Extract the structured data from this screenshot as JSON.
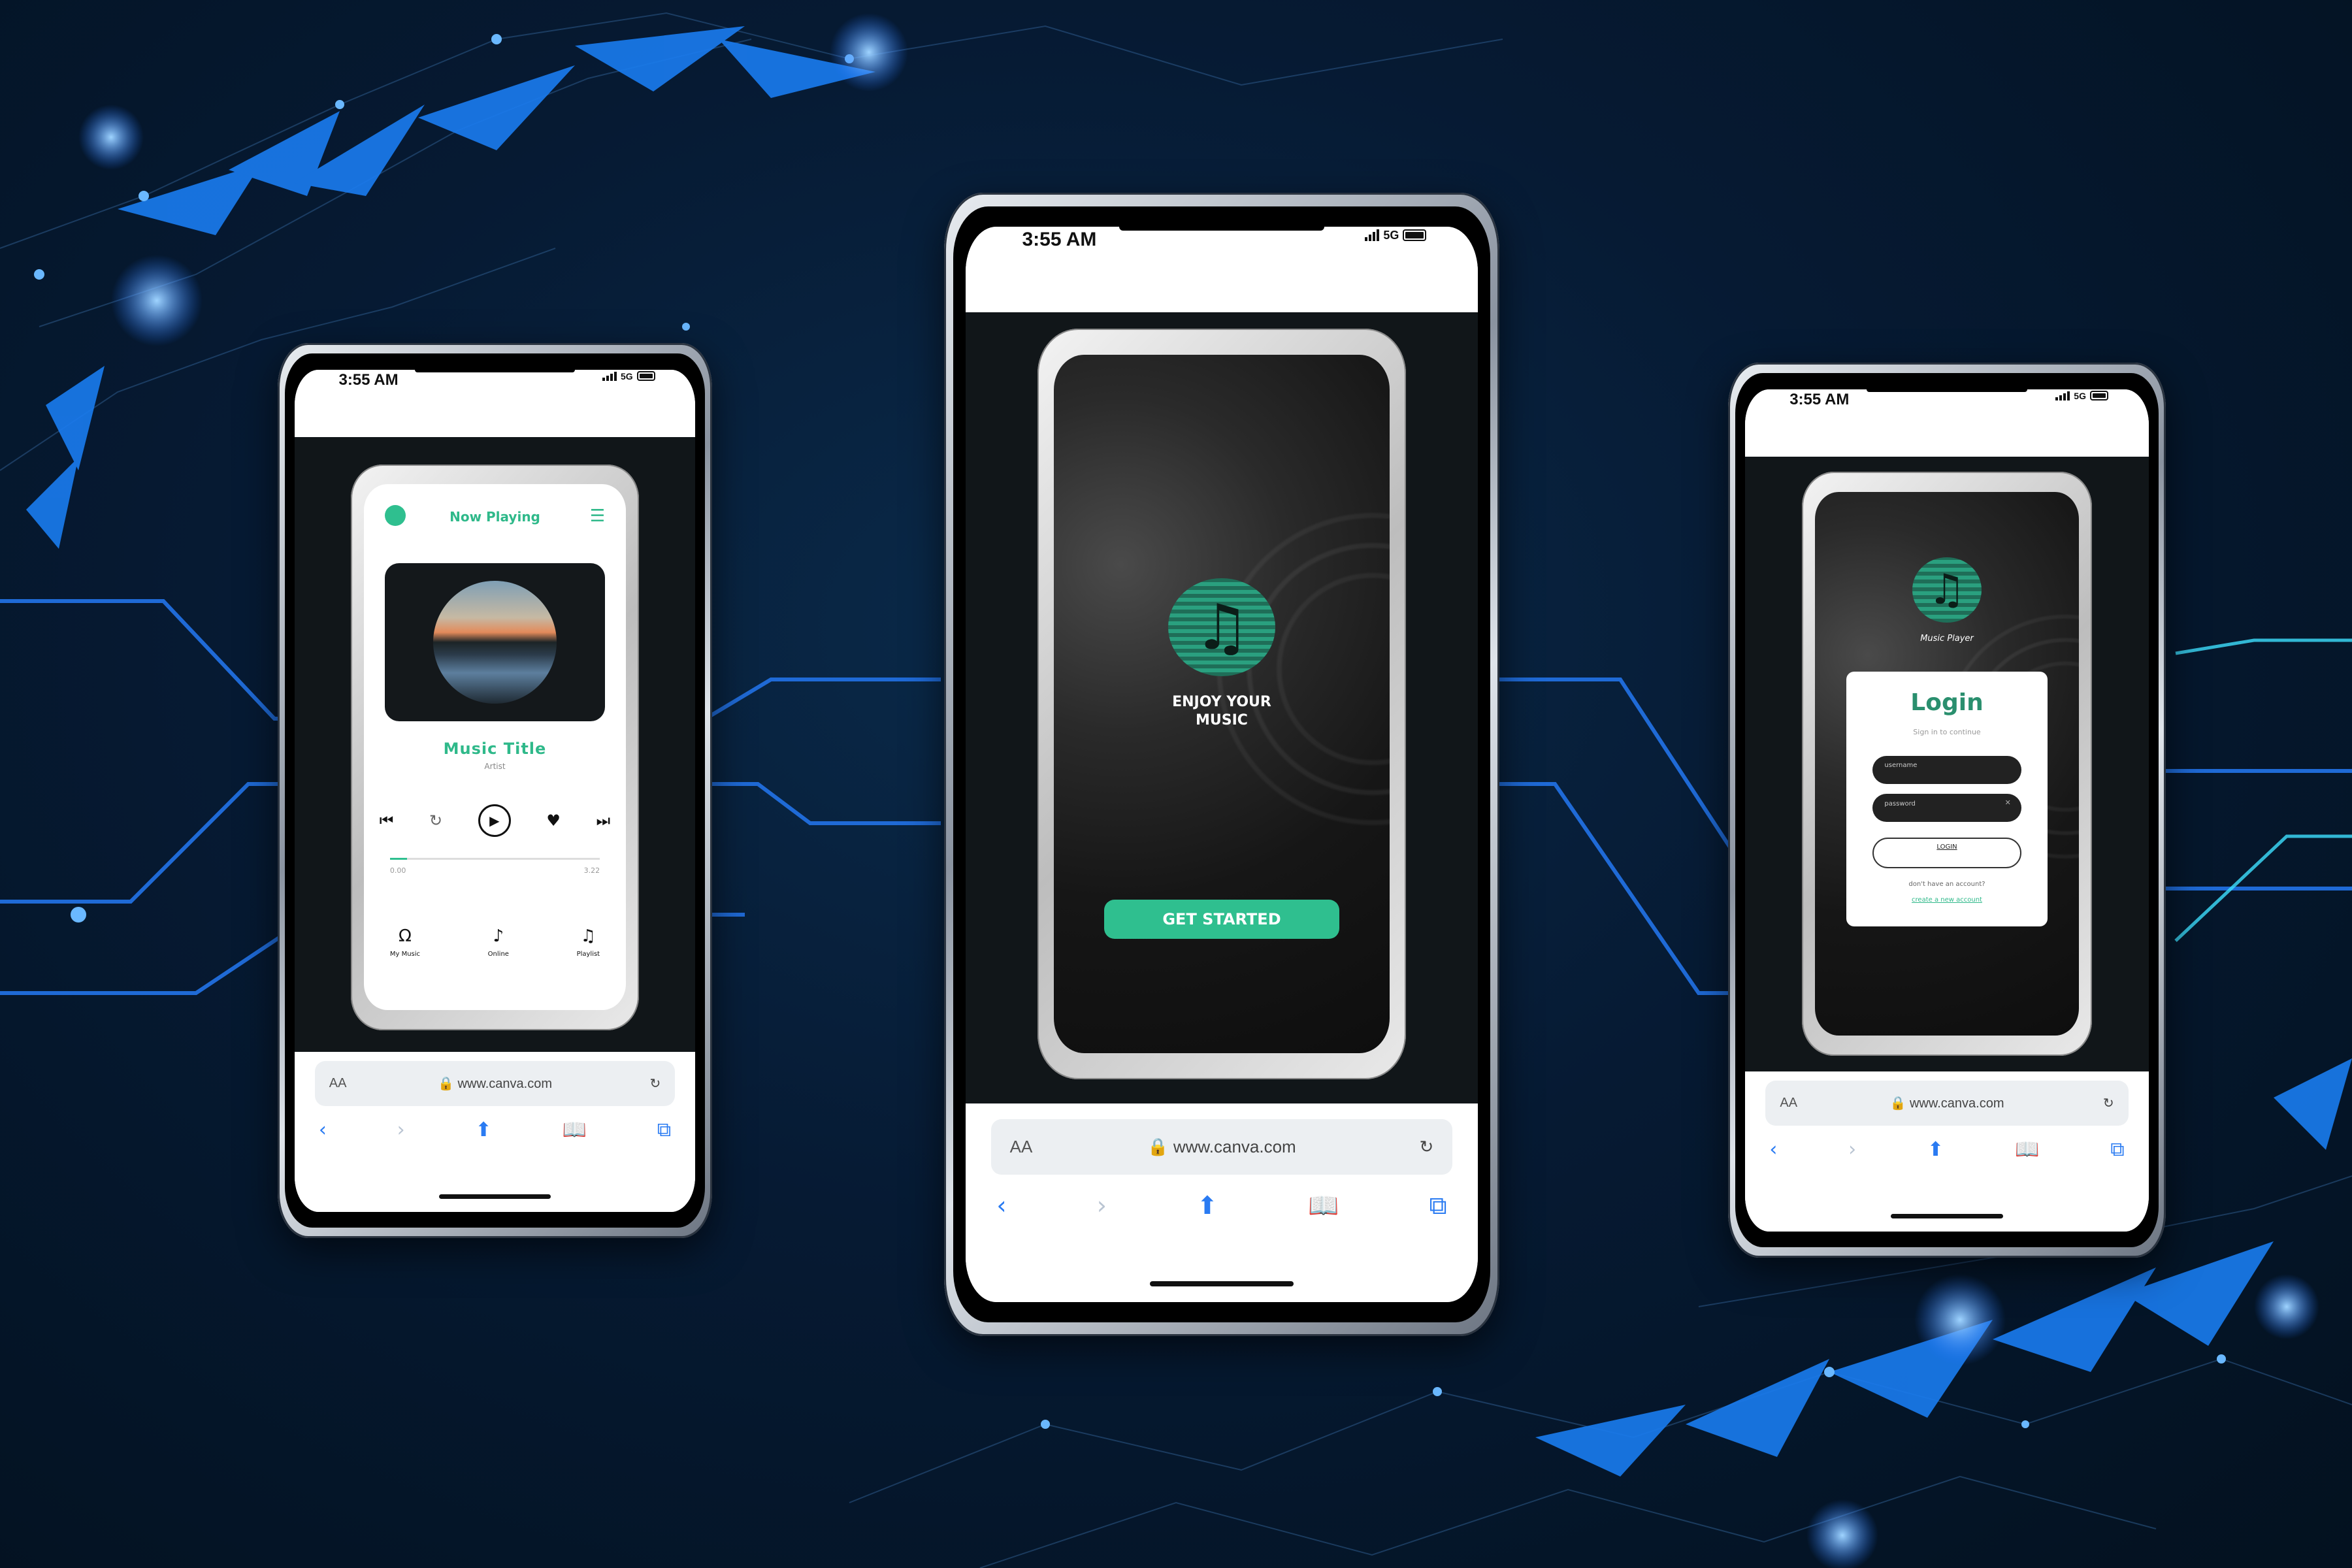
{
  "colors": {
    "accent": "#2fbf8f",
    "background": "#061a33",
    "browser_link": "#2a7bf2"
  },
  "status": {
    "time": "3:55 AM",
    "network": "5G"
  },
  "browser": {
    "aa": "AA",
    "url": "www.canva.com",
    "lock_icon": "lock-icon",
    "reload_icon": "reload-icon",
    "nav_icons": [
      "back-icon",
      "forward-icon",
      "share-icon",
      "bookmarks-icon",
      "tabs-icon"
    ]
  },
  "player": {
    "header_title": "Now Playing",
    "song_title": "Music Title",
    "artist": "Artist",
    "progress": {
      "current": "0.00",
      "total": "3.22",
      "fraction": 0.08
    },
    "tabs": [
      {
        "label": "My Music",
        "icon": "headphones-icon"
      },
      {
        "label": "Online",
        "icon": "music-note-icon"
      },
      {
        "label": "Playlist",
        "icon": "playlist-icon"
      }
    ]
  },
  "splash": {
    "tagline": "ENJOY YOUR MUSIC",
    "cta": "GET STARTED"
  },
  "login": {
    "app_name": "Music  Player",
    "title": "Login",
    "subtitle": "Sign in to continue",
    "username_placeholder": "username",
    "password_placeholder": "password",
    "button": "LOGIN",
    "no_account": "don't have an account?",
    "create_link": "create a new account"
  }
}
